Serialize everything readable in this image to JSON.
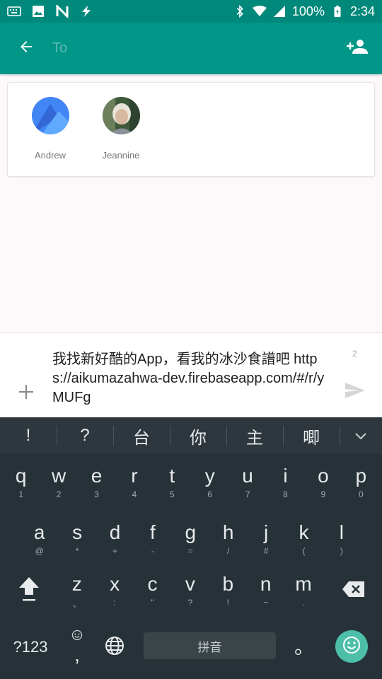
{
  "status_bar": {
    "icons_left": [
      "keyboard-icon",
      "image-icon",
      "n-icon",
      "flash-icon"
    ],
    "battery": "100%",
    "time": "2:34"
  },
  "app_bar": {
    "back_icon": "arrow-back-icon",
    "to_placeholder": "To",
    "add_contact_icon": "person-add-icon",
    "color": "#009688"
  },
  "contacts": [
    {
      "name": "Andrew"
    },
    {
      "name": "Jeannine"
    }
  ],
  "compose": {
    "message": "我找新好酷的App，看我的冰沙食譜吧 https://aikumazahwa-dev.firebaseapp.com/#/r/yMUFg",
    "char_count": "2",
    "attach_icon": "plus-icon",
    "send_icon": "send-icon"
  },
  "keyboard": {
    "suggestions": [
      "!",
      "?",
      "台",
      "你",
      "主",
      "唧"
    ],
    "row1": [
      {
        "k": "q",
        "s": "1"
      },
      {
        "k": "w",
        "s": "2"
      },
      {
        "k": "e",
        "s": "3"
      },
      {
        "k": "r",
        "s": "4"
      },
      {
        "k": "t",
        "s": "5"
      },
      {
        "k": "y",
        "s": "6"
      },
      {
        "k": "u",
        "s": "7"
      },
      {
        "k": "i",
        "s": "8"
      },
      {
        "k": "o",
        "s": "9"
      },
      {
        "k": "p",
        "s": "0"
      }
    ],
    "row2": [
      {
        "k": "a",
        "s": "@"
      },
      {
        "k": "s",
        "s": "*"
      },
      {
        "k": "d",
        "s": "+"
      },
      {
        "k": "f",
        "s": "-"
      },
      {
        "k": "g",
        "s": "="
      },
      {
        "k": "h",
        "s": "/"
      },
      {
        "k": "j",
        "s": "#"
      },
      {
        "k": "k",
        "s": "("
      },
      {
        "k": "l",
        "s": ")"
      }
    ],
    "row3": [
      {
        "k": "z",
        "s": "、"
      },
      {
        "k": "x",
        "s": ":"
      },
      {
        "k": "c",
        "s": "\""
      },
      {
        "k": "v",
        "s": "?"
      },
      {
        "k": "b",
        "s": "!"
      },
      {
        "k": "n",
        "s": "~"
      },
      {
        "k": "m",
        "s": "."
      }
    ],
    "symbols_key": "?123",
    "comma_key": ",",
    "space_label": "拼音",
    "period_key": "。",
    "bg": "#263238"
  }
}
